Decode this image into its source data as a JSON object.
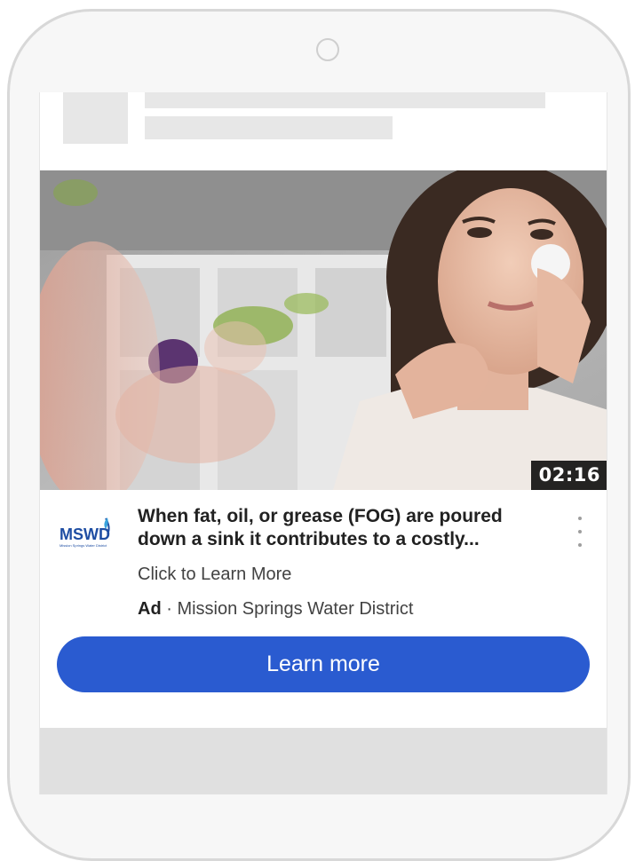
{
  "video": {
    "duration": "02:16"
  },
  "advertiser": {
    "logo_text": "MSWD",
    "logo_subtext": "Mission Springs Water District",
    "name": "Mission Springs Water District"
  },
  "ad": {
    "title": "When fat, oil, or grease (FOG) are poured down a sink it contributes to a costly...",
    "cta_text": "Click to Learn More",
    "badge": "Ad",
    "separator": " · ",
    "button_label": "Learn more"
  },
  "colors": {
    "button": "#2a5bd0",
    "logo_blue": "#1f4ea3"
  },
  "icons": {
    "menu": "more-vert-icon"
  }
}
